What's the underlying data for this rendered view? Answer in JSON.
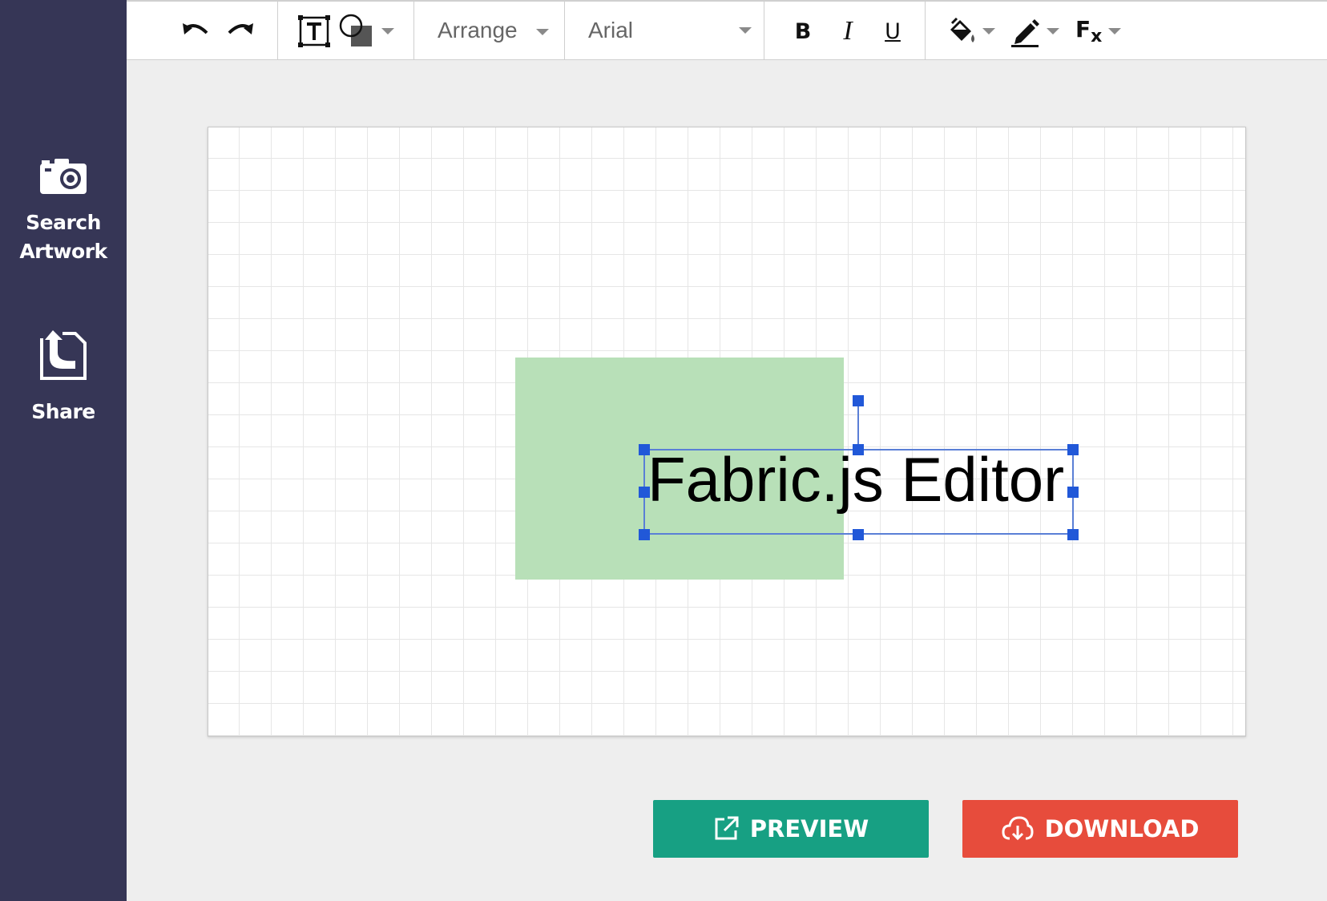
{
  "sidebar": {
    "items": [
      {
        "label": "Search Artwork",
        "icon": "camera-icon"
      },
      {
        "label": "Share",
        "icon": "share-upload-icon"
      }
    ],
    "background": "#363656"
  },
  "toolbar": {
    "arrange_label": "Arrange",
    "font_family_value": "Arial",
    "bold_label": "B",
    "italic_label": "I",
    "underline_label": "U",
    "effects_label": "F",
    "effects_sub": "x",
    "icons": [
      "undo-icon",
      "redo-icon",
      "text-box-icon",
      "shape-icon",
      "fill-bucket-icon",
      "pen-icon",
      "effects-icon"
    ]
  },
  "canvas": {
    "text_object": "Fabric.js Editor",
    "rect_color": "#b8e0b8",
    "selection_color": "#2158d8"
  },
  "actions": {
    "preview_label": "PREVIEW",
    "download_label": "DOWNLOAD",
    "preview_color": "#17a083",
    "download_color": "#e74c3c"
  }
}
